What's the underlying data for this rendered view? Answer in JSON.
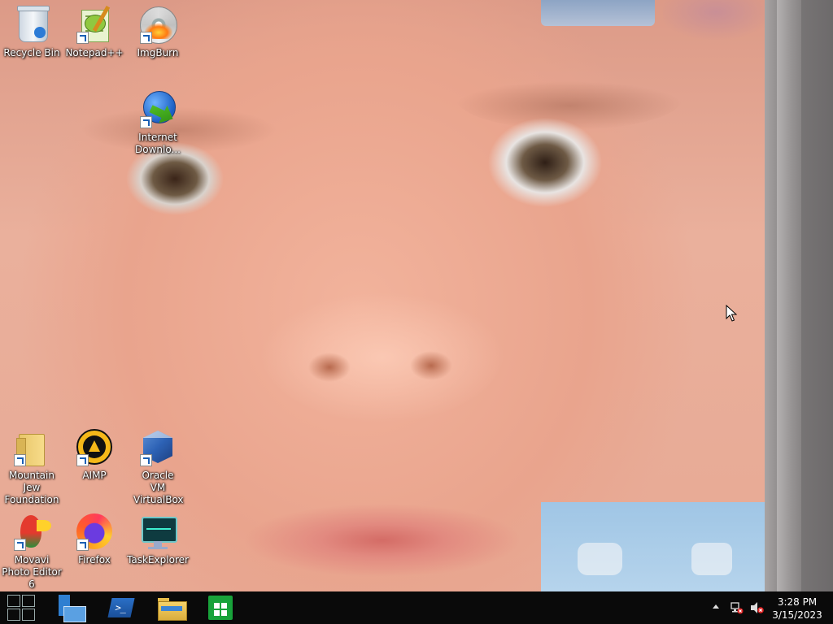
{
  "desktop": {
    "icons": [
      {
        "label": "Recycle Bin",
        "icon": "recycle-bin-icon"
      },
      {
        "label": "Notepad++",
        "icon": "notepad-plus-plus-icon"
      },
      {
        "label": "ImgBurn",
        "icon": "imgburn-icon"
      },
      {
        "label": "Internet Downlo...",
        "icon": "internet-download-manager-icon"
      },
      {
        "label": "Mountain Jew Foundation",
        "icon": "folder-icon"
      },
      {
        "label": "AIMP",
        "icon": "aimp-icon"
      },
      {
        "label": "Oracle VM VirtualBox",
        "icon": "virtualbox-icon"
      },
      {
        "label": "Movavi Photo Editor 6",
        "icon": "movavi-photo-editor-icon"
      },
      {
        "label": "Firefox",
        "icon": "firefox-icon"
      },
      {
        "label": "TaskExplorer",
        "icon": "taskexplorer-icon"
      }
    ]
  },
  "taskbar": {
    "pinned": [
      {
        "name": "Server Manager",
        "icon": "server-manager-icon"
      },
      {
        "name": "Windows PowerShell",
        "icon": "powershell-icon"
      },
      {
        "name": "File Explorer",
        "icon": "file-explorer-icon"
      },
      {
        "name": "Store",
        "icon": "store-icon"
      }
    ],
    "tray": {
      "time": "3:28 PM",
      "date": "3/15/2023"
    }
  },
  "colors": {
    "taskbar_bg": "#0a0a0a",
    "store_green": "#18a23a",
    "powershell_blue": "#2a6fc7"
  }
}
